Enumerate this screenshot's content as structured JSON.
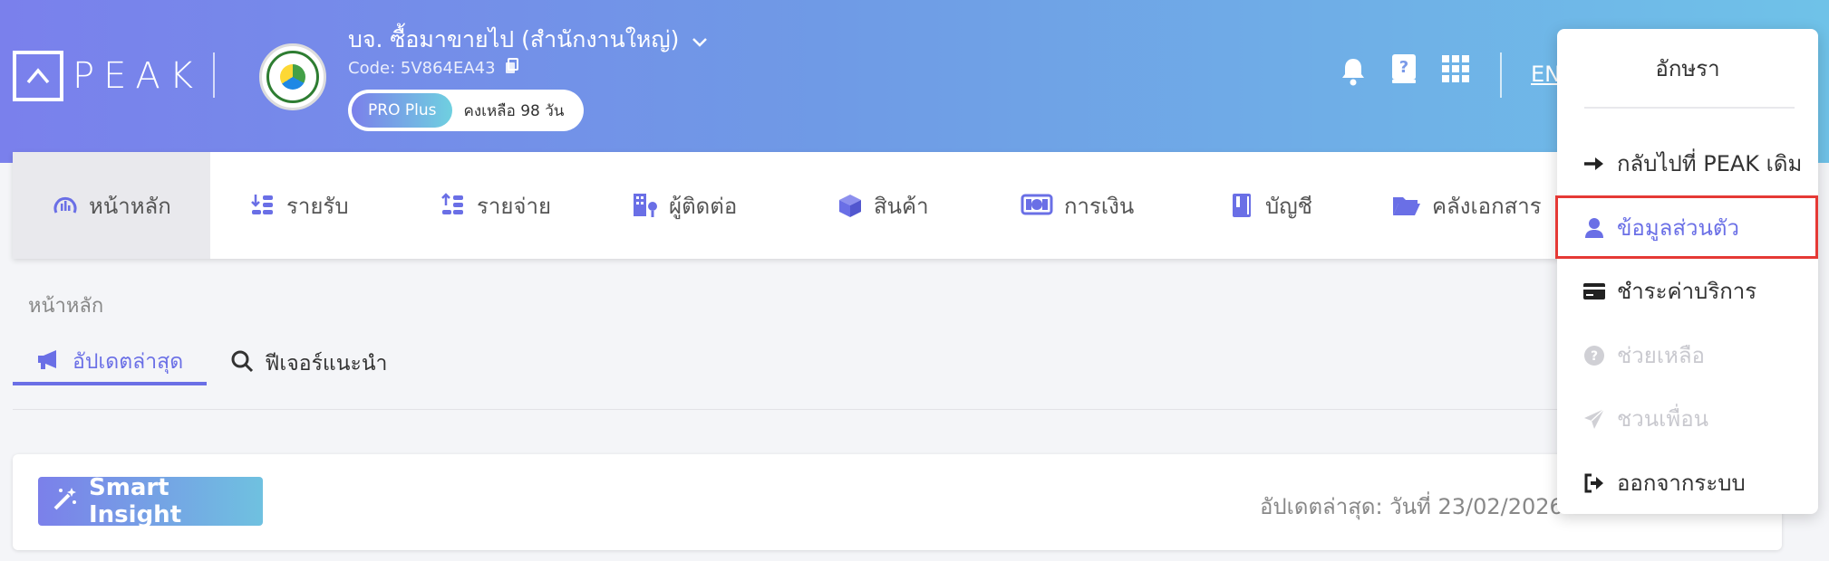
{
  "brand": {
    "logo_text": "PEAK"
  },
  "company": {
    "name": "บจ. ซื้อมาขายไป (สำนักงานใหญ่)",
    "code": "Code: 5V864EA43",
    "plan": "PRO Plus",
    "remaining": "คงเหลือ 98 วัน"
  },
  "header": {
    "lang": "EN"
  },
  "nav": {
    "items": [
      {
        "label": "หน้าหลัก",
        "icon": "dashboard-icon"
      },
      {
        "label": "รายรับ",
        "icon": "income-icon"
      },
      {
        "label": "รายจ่าย",
        "icon": "expense-icon"
      },
      {
        "label": "ผู้ติดต่อ",
        "icon": "contacts-icon"
      },
      {
        "label": "สินค้า",
        "icon": "box-icon"
      },
      {
        "label": "การเงิน",
        "icon": "money-icon"
      },
      {
        "label": "บัญชี",
        "icon": "book-icon"
      },
      {
        "label": "คลังเอกสาร",
        "icon": "folder-icon"
      }
    ]
  },
  "page": {
    "breadcrumb": "หน้าหลัก",
    "tabs": [
      {
        "label": "อัปเดตล่าสุด"
      },
      {
        "label": "ฟีเจอร์แนะนำ"
      }
    ],
    "smart_insight": "Smart Insight",
    "last_update": "อัปเดตล่าสุด: วันที่ 23/02/2026"
  },
  "user_menu": {
    "username": "อักษรา",
    "items": [
      {
        "label": "กลับไปที่ PEAK เดิม",
        "icon": "arrow-right-icon"
      },
      {
        "label": "ข้อมูลส่วนตัว",
        "icon": "user-icon"
      },
      {
        "label": "ชำระค่าบริการ",
        "icon": "credit-card-icon"
      },
      {
        "label": "ช่วยเหลือ",
        "icon": "help-icon"
      },
      {
        "label": "ชวนเพื่อน",
        "icon": "send-icon"
      },
      {
        "label": "ออกจากระบบ",
        "icon": "logout-icon"
      }
    ]
  },
  "colors": {
    "accent": "#6a6fe6",
    "highlight": "#e53935"
  }
}
